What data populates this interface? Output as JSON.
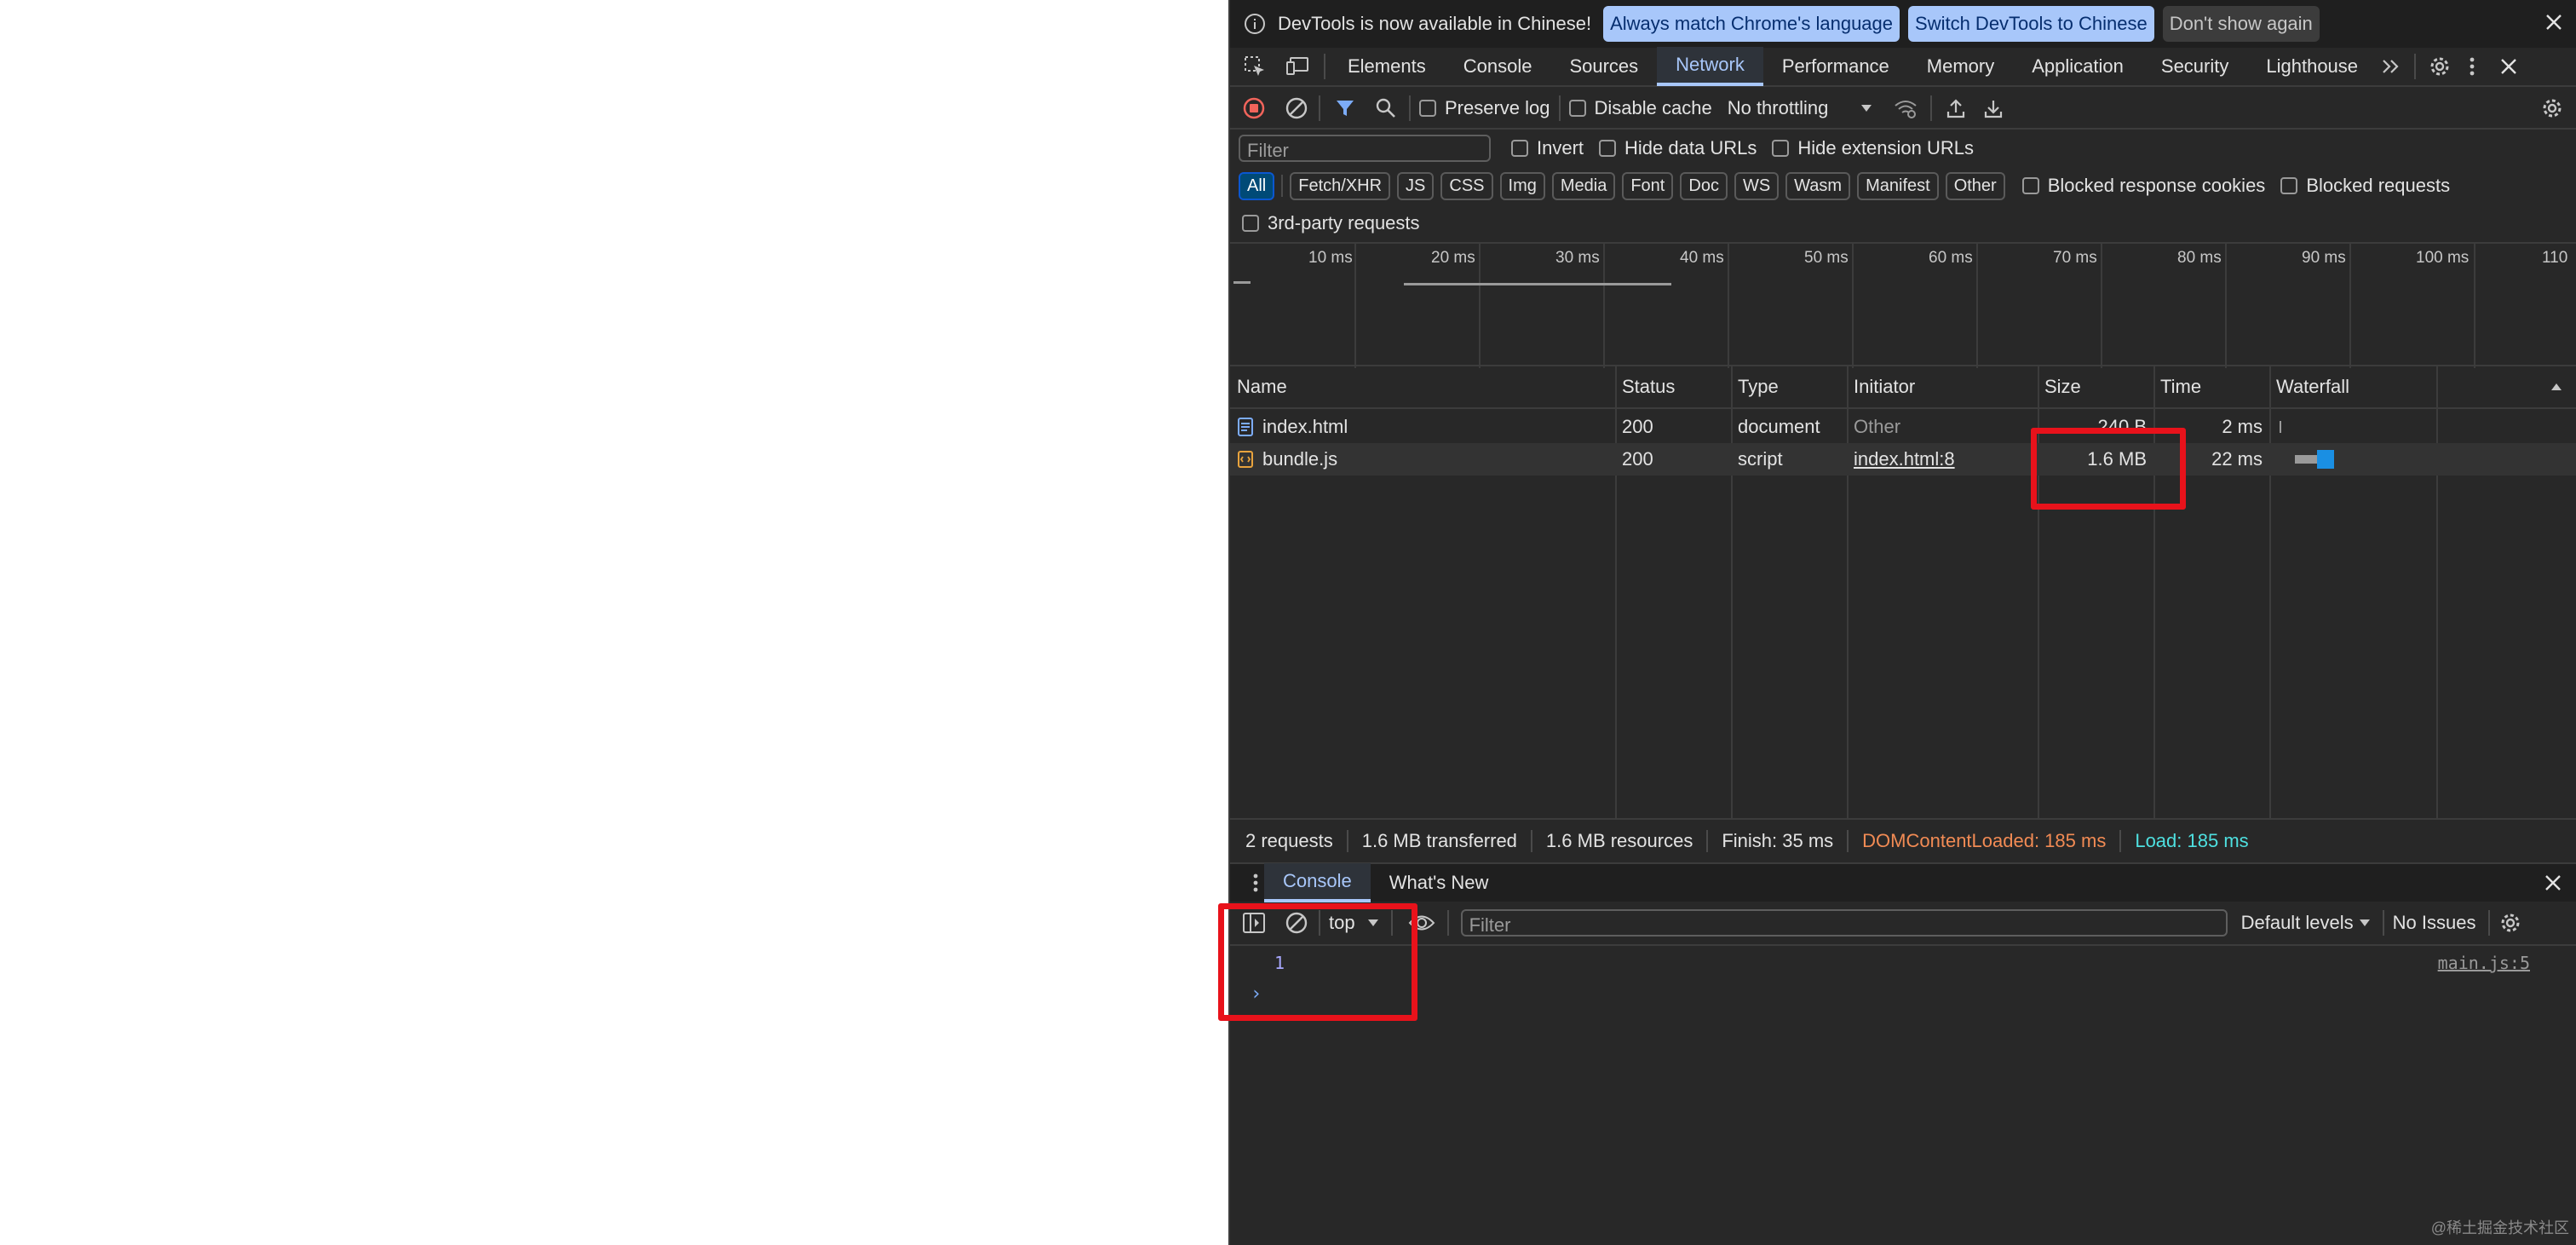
{
  "infobar": {
    "message": "DevTools is now available in Chinese!",
    "match_label": "Always match Chrome's language",
    "switch_label": "Switch DevTools to Chinese",
    "dismiss_label": "Don't show again"
  },
  "tabs": [
    {
      "label": "Elements"
    },
    {
      "label": "Console"
    },
    {
      "label": "Sources"
    },
    {
      "label": "Network",
      "active": true
    },
    {
      "label": "Performance"
    },
    {
      "label": "Memory"
    },
    {
      "label": "Application"
    },
    {
      "label": "Security"
    },
    {
      "label": "Lighthouse"
    }
  ],
  "network_toolbar": {
    "preserve_log": "Preserve log",
    "disable_cache": "Disable cache",
    "throttling": "No throttling"
  },
  "filter_bar": {
    "placeholder": "Filter",
    "invert": "Invert",
    "hide_data_urls": "Hide data URLs",
    "hide_extension_urls": "Hide extension URLs"
  },
  "type_filters": [
    "All",
    "Fetch/XHR",
    "JS",
    "CSS",
    "Img",
    "Media",
    "Font",
    "Doc",
    "WS",
    "Wasm",
    "Manifest",
    "Other"
  ],
  "blocked_response_cookies": "Blocked response cookies",
  "blocked_requests": "Blocked requests",
  "third_party": "3rd-party requests",
  "overview_ticks": [
    "10 ms",
    "20 ms",
    "30 ms",
    "40 ms",
    "50 ms",
    "60 ms",
    "70 ms",
    "80 ms",
    "90 ms",
    "100 ms",
    "110"
  ],
  "columns": {
    "name": "Name",
    "status": "Status",
    "type": "Type",
    "initiator": "Initiator",
    "size": "Size",
    "time": "Time",
    "waterfall": "Waterfall"
  },
  "requests": [
    {
      "name": "index.html",
      "status": "200",
      "type": "document",
      "initiator": "Other",
      "size": "240 B",
      "time": "2 ms"
    },
    {
      "name": "bundle.js",
      "status": "200",
      "type": "script",
      "initiator": "index.html:8",
      "size": "1.6 MB",
      "time": "22 ms"
    }
  ],
  "summary": {
    "requests": "2 requests",
    "transferred": "1.6 MB transferred",
    "resources": "1.6 MB resources",
    "finish": "Finish: 35 ms",
    "dcl": "DOMContentLoaded: 185 ms",
    "load": "Load: 185 ms"
  },
  "drawer": {
    "tab_console": "Console",
    "tab_whats_new": "What's New",
    "context": "top",
    "filter_placeholder": "Filter",
    "levels": "Default levels",
    "issues": "No Issues"
  },
  "console": {
    "log_value": "1",
    "log_source": "main.js:5",
    "prompt": "›"
  },
  "watermark": "@稀土掘金技术社区",
  "colors": {
    "accent": "#a8c7fa",
    "highlight": "#e8121b",
    "dcl": "#f28b54",
    "load": "#4ee0e0"
  }
}
